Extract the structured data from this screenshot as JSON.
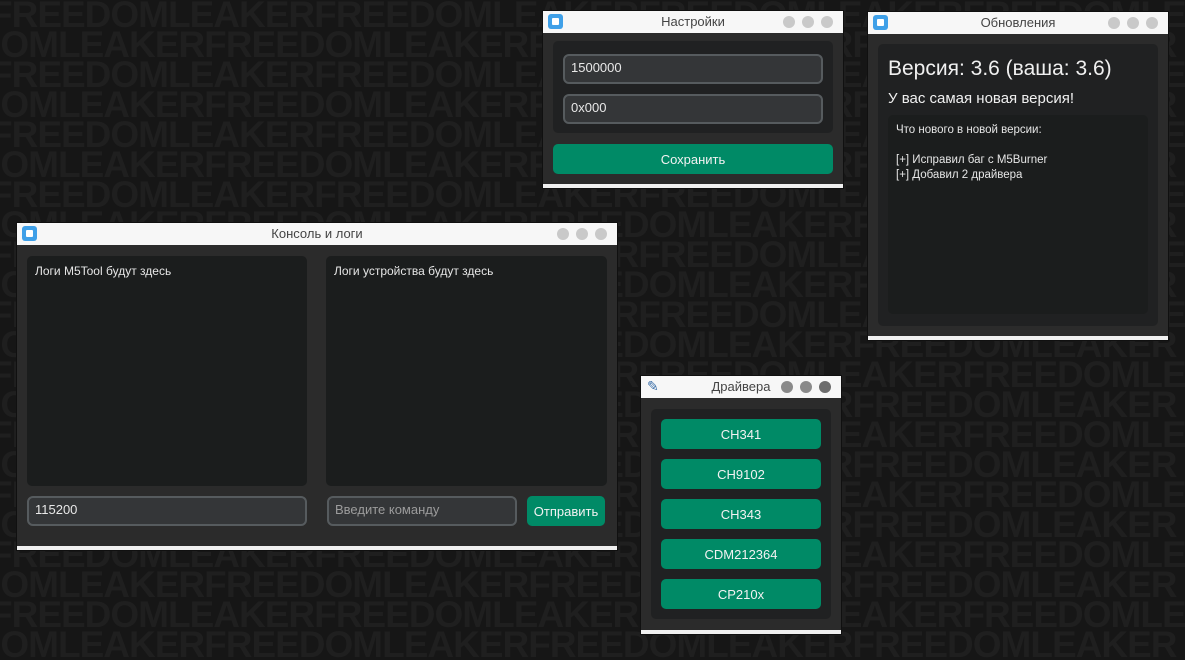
{
  "background": {
    "watermark": "FREEDOMLEAKER"
  },
  "settings_window": {
    "title": "Настройки",
    "baud_value": "1500000",
    "address_value": "0x000",
    "save_label": "Сохранить"
  },
  "updates_window": {
    "title": "Обновления",
    "version_text": "Версия: 3.6 (ваша: 3.6)",
    "status_text": "У вас самая новая версия!",
    "changelog": {
      "heading": "Что нового в новой версии:",
      "items": [
        "[+] Исправил баг с M5Burner",
        "[+] Добавил 2 драйвера"
      ]
    }
  },
  "console_window": {
    "title": "Консоль и логи",
    "tool_log_text": "Логи M5Tool будут здесь",
    "device_log_text": "Логи устройства будут здесь",
    "baud_value": "115200",
    "command_placeholder": "Введите команду",
    "send_label": "Отправить"
  },
  "drivers_window": {
    "title": "Драйвера",
    "buttons": [
      "CH341",
      "CH9102",
      "CH343",
      "CDM212364",
      "CP210x"
    ]
  },
  "colors": {
    "accent": "#008a66",
    "window_bg": "#2b2b2b",
    "field_bg": "#343638",
    "log_bg": "#1b1d1d"
  }
}
